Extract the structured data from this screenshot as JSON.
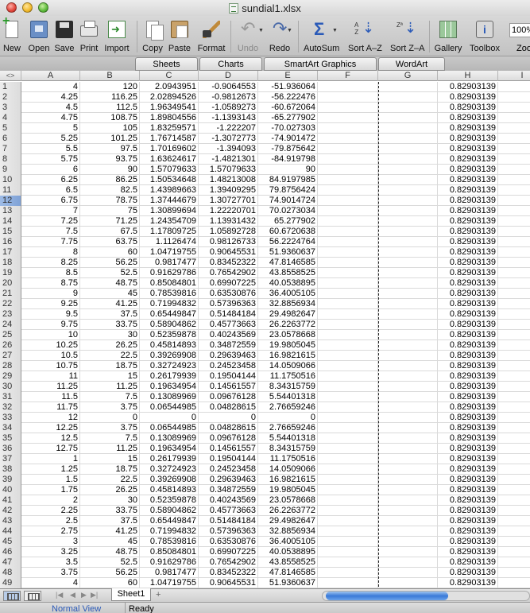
{
  "window": {
    "title": "sundial1.xlsx"
  },
  "toolbar": {
    "buttons": [
      {
        "id": "new",
        "label": "New"
      },
      {
        "id": "open",
        "label": "Open"
      },
      {
        "id": "save",
        "label": "Save"
      },
      {
        "id": "print",
        "label": "Print"
      },
      {
        "id": "import",
        "label": "Import"
      },
      {
        "id": "copy",
        "label": "Copy"
      },
      {
        "id": "paste",
        "label": "Paste"
      },
      {
        "id": "format",
        "label": "Format"
      },
      {
        "id": "undo",
        "label": "Undo",
        "disabled": true
      },
      {
        "id": "redo",
        "label": "Redo"
      },
      {
        "id": "autosum",
        "label": "AutoSum"
      },
      {
        "id": "sort-az",
        "label": "Sort A–Z"
      },
      {
        "id": "sort-za",
        "label": "Sort Z–A"
      },
      {
        "id": "gallery",
        "label": "Gallery"
      },
      {
        "id": "toolbox",
        "label": "Toolbox"
      }
    ],
    "zoom_value": "100%",
    "zoom_label": "Zoom"
  },
  "ribbon": {
    "tabs": [
      "Sheets",
      "Charts",
      "SmartArt Graphics",
      "WordArt"
    ]
  },
  "columns": [
    "A",
    "B",
    "C",
    "D",
    "E",
    "F",
    "G",
    "H",
    "I"
  ],
  "corner_glyph": "<>",
  "selected_row": 12,
  "rows": [
    {
      "n": "1",
      "A": "4",
      "B": "120",
      "C": "2.0943951",
      "D": "-0.9064553",
      "E": "-51.936064",
      "H": "0.82903139"
    },
    {
      "n": "2",
      "A": "4.25",
      "B": "116.25",
      "C": "2.02894526",
      "D": "-0.9812673",
      "E": "-56.222476",
      "H": "0.82903139"
    },
    {
      "n": "3",
      "A": "4.5",
      "B": "112.5",
      "C": "1.96349541",
      "D": "-1.0589273",
      "E": "-60.672064",
      "H": "0.82903139"
    },
    {
      "n": "4",
      "A": "4.75",
      "B": "108.75",
      "C": "1.89804556",
      "D": "-1.1393143",
      "E": "-65.277902",
      "H": "0.82903139"
    },
    {
      "n": "5",
      "A": "5",
      "B": "105",
      "C": "1.83259571",
      "D": "-1.222207",
      "E": "-70.027303",
      "H": "0.82903139"
    },
    {
      "n": "6",
      "A": "5.25",
      "B": "101.25",
      "C": "1.76714587",
      "D": "-1.3072773",
      "E": "-74.901472",
      "H": "0.82903139"
    },
    {
      "n": "7",
      "A": "5.5",
      "B": "97.5",
      "C": "1.70169602",
      "D": "-1.394093",
      "E": "-79.875642",
      "H": "0.82903139"
    },
    {
      "n": "8",
      "A": "5.75",
      "B": "93.75",
      "C": "1.63624617",
      "D": "-1.4821301",
      "E": "-84.919798",
      "H": "0.82903139"
    },
    {
      "n": "9",
      "A": "6",
      "B": "90",
      "C": "1.57079633",
      "D": "1.57079633",
      "E": "90",
      "H": "0.82903139"
    },
    {
      "n": "10",
      "A": "6.25",
      "B": "86.25",
      "C": "1.50534648",
      "D": "1.48213008",
      "E": "84.9197985",
      "H": "0.82903139"
    },
    {
      "n": "11",
      "A": "6.5",
      "B": "82.5",
      "C": "1.43989663",
      "D": "1.39409295",
      "E": "79.8756424",
      "H": "0.82903139"
    },
    {
      "n": "12",
      "A": "6.75",
      "B": "78.75",
      "C": "1.37444679",
      "D": "1.30727701",
      "E": "74.9014724",
      "H": "0.82903139"
    },
    {
      "n": "13",
      "A": "7",
      "B": "75",
      "C": "1.30899694",
      "D": "1.22220701",
      "E": "70.0273034",
      "H": "0.82903139"
    },
    {
      "n": "14",
      "A": "7.25",
      "B": "71.25",
      "C": "1.24354709",
      "D": "1.13931432",
      "E": "65.277902",
      "H": "0.82903139"
    },
    {
      "n": "15",
      "A": "7.5",
      "B": "67.5",
      "C": "1.17809725",
      "D": "1.05892728",
      "E": "60.6720638",
      "H": "0.82903139"
    },
    {
      "n": "16",
      "A": "7.75",
      "B": "63.75",
      "C": "1.1126474",
      "D": "0.98126733",
      "E": "56.2224764",
      "H": "0.82903139"
    },
    {
      "n": "17",
      "A": "8",
      "B": "60",
      "C": "1.04719755",
      "D": "0.90645531",
      "E": "51.9360637",
      "H": "0.82903139"
    },
    {
      "n": "18",
      "A": "8.25",
      "B": "56.25",
      "C": "0.9817477",
      "D": "0.83452322",
      "E": "47.8146585",
      "H": "0.82903139"
    },
    {
      "n": "19",
      "A": "8.5",
      "B": "52.5",
      "C": "0.91629786",
      "D": "0.76542902",
      "E": "43.8558525",
      "H": "0.82903139"
    },
    {
      "n": "20",
      "A": "8.75",
      "B": "48.75",
      "C": "0.85084801",
      "D": "0.69907225",
      "E": "40.0538895",
      "H": "0.82903139"
    },
    {
      "n": "21",
      "A": "9",
      "B": "45",
      "C": "0.78539816",
      "D": "0.63530876",
      "E": "36.4005105",
      "H": "0.82903139"
    },
    {
      "n": "22",
      "A": "9.25",
      "B": "41.25",
      "C": "0.71994832",
      "D": "0.57396363",
      "E": "32.8856934",
      "H": "0.82903139"
    },
    {
      "n": "23",
      "A": "9.5",
      "B": "37.5",
      "C": "0.65449847",
      "D": "0.51484184",
      "E": "29.4982647",
      "H": "0.82903139"
    },
    {
      "n": "24",
      "A": "9.75",
      "B": "33.75",
      "C": "0.58904862",
      "D": "0.45773663",
      "E": "26.2263772",
      "H": "0.82903139"
    },
    {
      "n": "25",
      "A": "10",
      "B": "30",
      "C": "0.52359878",
      "D": "0.40243569",
      "E": "23.0578668",
      "H": "0.82903139"
    },
    {
      "n": "26",
      "A": "10.25",
      "B": "26.25",
      "C": "0.45814893",
      "D": "0.34872559",
      "E": "19.9805045",
      "H": "0.82903139"
    },
    {
      "n": "27",
      "A": "10.5",
      "B": "22.5",
      "C": "0.39269908",
      "D": "0.29639463",
      "E": "16.9821615",
      "H": "0.82903139"
    },
    {
      "n": "28",
      "A": "10.75",
      "B": "18.75",
      "C": "0.32724923",
      "D": "0.24523458",
      "E": "14.0509066",
      "H": "0.82903139"
    },
    {
      "n": "29",
      "A": "11",
      "B": "15",
      "C": "0.26179939",
      "D": "0.19504144",
      "E": "11.1750516",
      "H": "0.82903139"
    },
    {
      "n": "30",
      "A": "11.25",
      "B": "11.25",
      "C": "0.19634954",
      "D": "0.14561557",
      "E": "8.34315759",
      "H": "0.82903139"
    },
    {
      "n": "31",
      "A": "11.5",
      "B": "7.5",
      "C": "0.13089969",
      "D": "0.09676128",
      "E": "5.54401318",
      "H": "0.82903139"
    },
    {
      "n": "32",
      "A": "11.75",
      "B": "3.75",
      "C": "0.06544985",
      "D": "0.04828615",
      "E": "2.76659246",
      "H": "0.82903139"
    },
    {
      "n": "33",
      "A": "12",
      "B": "0",
      "C": "0",
      "D": "0",
      "E": "0",
      "H": "0.82903139"
    },
    {
      "n": "34",
      "A": "12.25",
      "B": "3.75",
      "C": "0.06544985",
      "D": "0.04828615",
      "E": "2.76659246",
      "H": "0.82903139"
    },
    {
      "n": "35",
      "A": "12.5",
      "B": "7.5",
      "C": "0.13089969",
      "D": "0.09676128",
      "E": "5.54401318",
      "H": "0.82903139"
    },
    {
      "n": "36",
      "A": "12.75",
      "B": "11.25",
      "C": "0.19634954",
      "D": "0.14561557",
      "E": "8.34315759",
      "H": "0.82903139"
    },
    {
      "n": "37",
      "A": "1",
      "B": "15",
      "C": "0.26179939",
      "D": "0.19504144",
      "E": "11.1750516",
      "H": "0.82903139"
    },
    {
      "n": "38",
      "A": "1.25",
      "B": "18.75",
      "C": "0.32724923",
      "D": "0.24523458",
      "E": "14.0509066",
      "H": "0.82903139"
    },
    {
      "n": "39",
      "A": "1.5",
      "B": "22.5",
      "C": "0.39269908",
      "D": "0.29639463",
      "E": "16.9821615",
      "H": "0.82903139"
    },
    {
      "n": "40",
      "A": "1.75",
      "B": "26.25",
      "C": "0.45814893",
      "D": "0.34872559",
      "E": "19.9805045",
      "H": "0.82903139"
    },
    {
      "n": "41",
      "A": "2",
      "B": "30",
      "C": "0.52359878",
      "D": "0.40243569",
      "E": "23.0578668",
      "H": "0.82903139"
    },
    {
      "n": "42",
      "A": "2.25",
      "B": "33.75",
      "C": "0.58904862",
      "D": "0.45773663",
      "E": "26.2263772",
      "H": "0.82903139"
    },
    {
      "n": "43",
      "A": "2.5",
      "B": "37.5",
      "C": "0.65449847",
      "D": "0.51484184",
      "E": "29.4982647",
      "H": "0.82903139"
    },
    {
      "n": "44",
      "A": "2.75",
      "B": "41.25",
      "C": "0.71994832",
      "D": "0.57396363",
      "E": "32.8856934",
      "H": "0.82903139"
    },
    {
      "n": "45",
      "A": "3",
      "B": "45",
      "C": "0.78539816",
      "D": "0.63530876",
      "E": "36.4005105",
      "H": "0.82903139"
    },
    {
      "n": "46",
      "A": "3.25",
      "B": "48.75",
      "C": "0.85084801",
      "D": "0.69907225",
      "E": "40.0538895",
      "H": "0.82903139"
    },
    {
      "n": "47",
      "A": "3.5",
      "B": "52.5",
      "C": "0.91629786",
      "D": "0.76542902",
      "E": "43.8558525",
      "H": "0.82903139"
    },
    {
      "n": "48",
      "A": "3.75",
      "B": "56.25",
      "C": "0.9817477",
      "D": "0.83452322",
      "E": "47.8146585",
      "H": "0.82903139"
    },
    {
      "n": "49",
      "A": "4",
      "B": "60",
      "C": "1.04719755",
      "D": "0.90645531",
      "E": "51.9360637",
      "H": "0.82903139"
    }
  ],
  "sheet_tabs": [
    "Sheet1"
  ],
  "status": {
    "view": "Normal View",
    "state": "Ready"
  }
}
